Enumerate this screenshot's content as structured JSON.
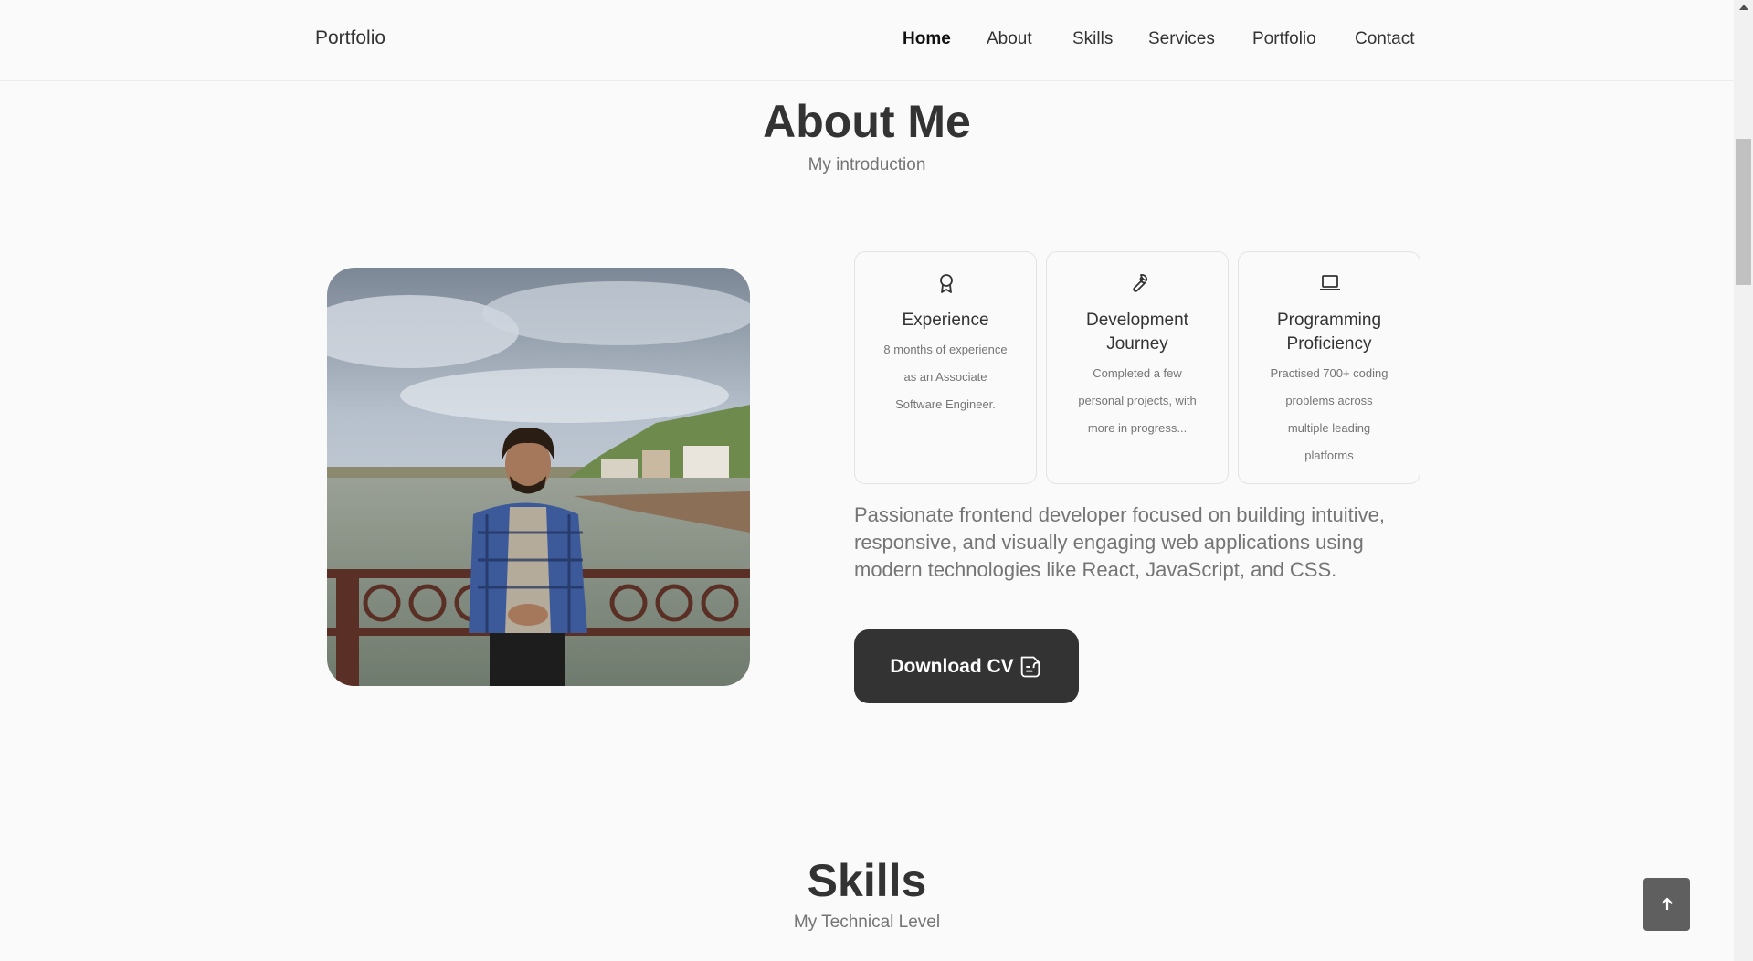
{
  "header": {
    "logo": "Portfolio",
    "nav": [
      "Home",
      "About",
      "Skills",
      "Services",
      "Portfolio",
      "Contact"
    ],
    "active": "Home"
  },
  "about": {
    "title": "About Me",
    "subtitle": "My introduction",
    "cards": [
      {
        "icon": "award-icon",
        "title": "Experience",
        "desc": [
          "8 months of experience",
          "as an Associate",
          "Software Engineer."
        ]
      },
      {
        "icon": "wrench-icon",
        "title": [
          "Development",
          "Journey"
        ],
        "desc": [
          "Completed a few",
          "personal projects, with",
          "more in progress..."
        ]
      },
      {
        "icon": "laptop-icon",
        "title": [
          "Programming",
          "Proficiency"
        ],
        "desc": [
          "Practised 700+ coding",
          "problems across",
          "multiple leading",
          "platforms"
        ]
      }
    ],
    "description": "Passionate frontend developer focused on building intuitive, responsive, and visually engaging web applications using modern technologies like React, JavaScript, and CSS.",
    "download_label": "Download CV"
  },
  "skills": {
    "title": "Skills",
    "subtitle": "My Technical Level"
  },
  "colors": {
    "text": "#333333",
    "muted": "#757575",
    "background": "#fafafa",
    "button": "#333333"
  }
}
